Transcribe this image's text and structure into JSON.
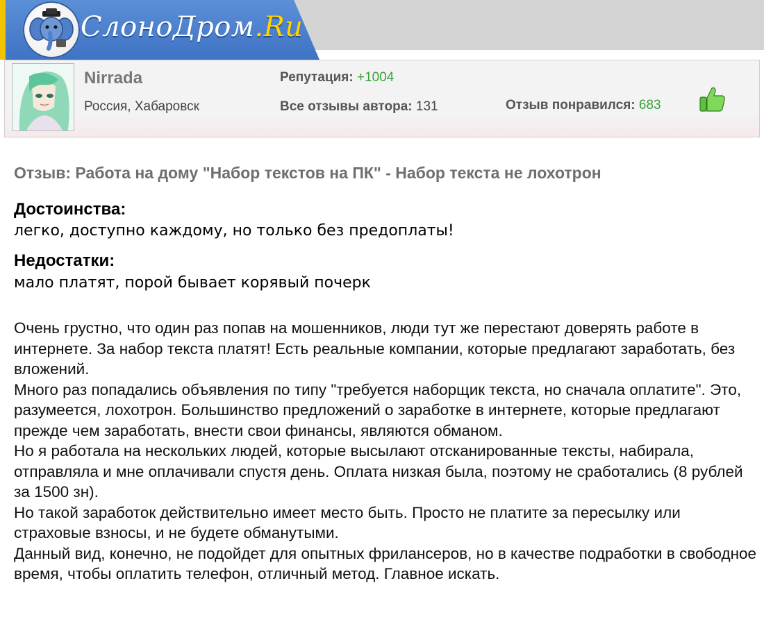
{
  "site": {
    "logo_text": "СлоноДром",
    "logo_domain": ".Ru"
  },
  "profile": {
    "username": "Nirrada",
    "location": "Россия, Хабаровск",
    "reputation_label": "Репутация: ",
    "reputation_value": "+1004",
    "all_reviews_label": "Все отзывы автора: ",
    "all_reviews_value": "131",
    "liked_label": "Отзыв понравился: ",
    "liked_value": "683"
  },
  "review": {
    "title": "Отзыв: Работа на дому \"Набор текстов на ПК\" - Набор текста не лохотрон",
    "pros_heading": "Достоинства:",
    "pros": "легко, доступно каждому, но только без предоплаты!",
    "cons_heading": "Недостатки:",
    "cons": "мало платят, порой бывает корявый почерк",
    "paragraphs": [
      "Очень грустно, что один раз попав на мошенников, люди тут же перестают доверять работе в интернете. За набор текста платят! Есть реальные компании, которые предлагают заработать, без вложений.",
      "Много раз попадались объявления по типу \"требуется наборщик текста, но сначала оплатите\". Это, разумеется, лохотрон. Большинство предложений о заработке в интернете, которые предлагают прежде чем заработать, внести свои финансы, являются обманом.",
      "Но я работала на нескольких людей, которые высылают отсканированные тексты, набирала, отправляла и мне оплачивали спустя день. Оплата низкая была, поэтому не сработались (8 рублей за 1500 зн).",
      "Но такой заработок действительно имеет место быть. Просто не платите за пересылку или страховые взносы, и не будете обманутыми.",
      "Данный вид, конечно, не подойдет для опытных фрилансеров, но в качестве подработки в свободное время, чтобы оплатить телефон, отличный метод. Главное искать."
    ]
  },
  "colors": {
    "accent_blue": "#3f73c4",
    "positive_green": "#3aa13a",
    "logo_yellow": "#f2c300"
  },
  "icons": {
    "logo_mascot": "elephant-icon",
    "like": "thumbs-up-icon"
  }
}
